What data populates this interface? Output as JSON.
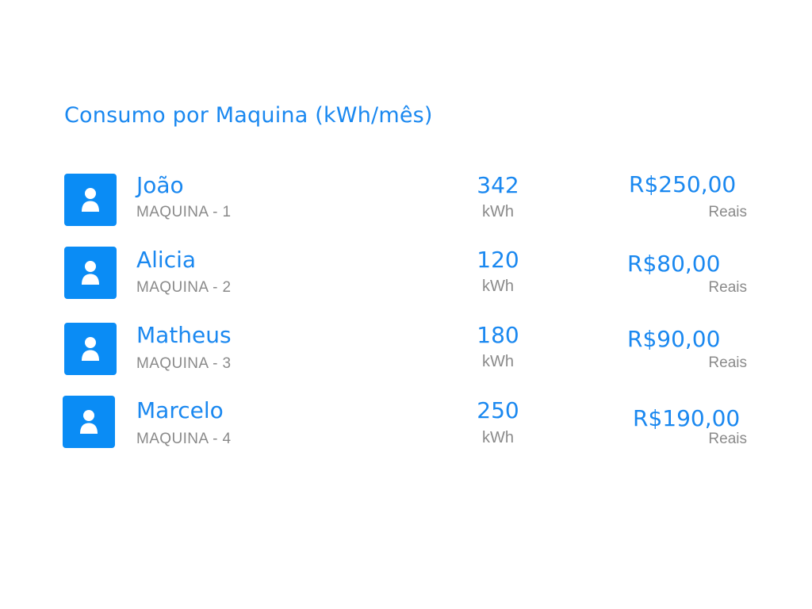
{
  "title": "Consumo por Maquina (kWh/mês)",
  "colors": {
    "accent": "#1a88f0",
    "avatar_bg": "#0a8cf5",
    "secondary_text": "#8a8a8a",
    "background": "#ffffff"
  },
  "rows": [
    {
      "name": "João",
      "machine": "MAQUINA - 1",
      "kwh": "342",
      "kwh_unit": "kWh",
      "price": "R$250,00",
      "currency_label": "Reais",
      "icon": "user-icon"
    },
    {
      "name": "Alicia",
      "machine": "MAQUINA - 2",
      "kwh": "120",
      "kwh_unit": "kWh",
      "price": "R$80,00",
      "currency_label": "Reais",
      "icon": "user-icon"
    },
    {
      "name": "Matheus",
      "machine": "MAQUINA - 3",
      "kwh": "180",
      "kwh_unit": "kWh",
      "price": "R$90,00",
      "currency_label": "Reais",
      "icon": "user-icon"
    },
    {
      "name": "Marcelo",
      "machine": "MAQUINA - 4",
      "kwh": "250",
      "kwh_unit": "kWh",
      "price": "R$190,00",
      "currency_label": "Reais",
      "icon": "user-icon"
    }
  ]
}
